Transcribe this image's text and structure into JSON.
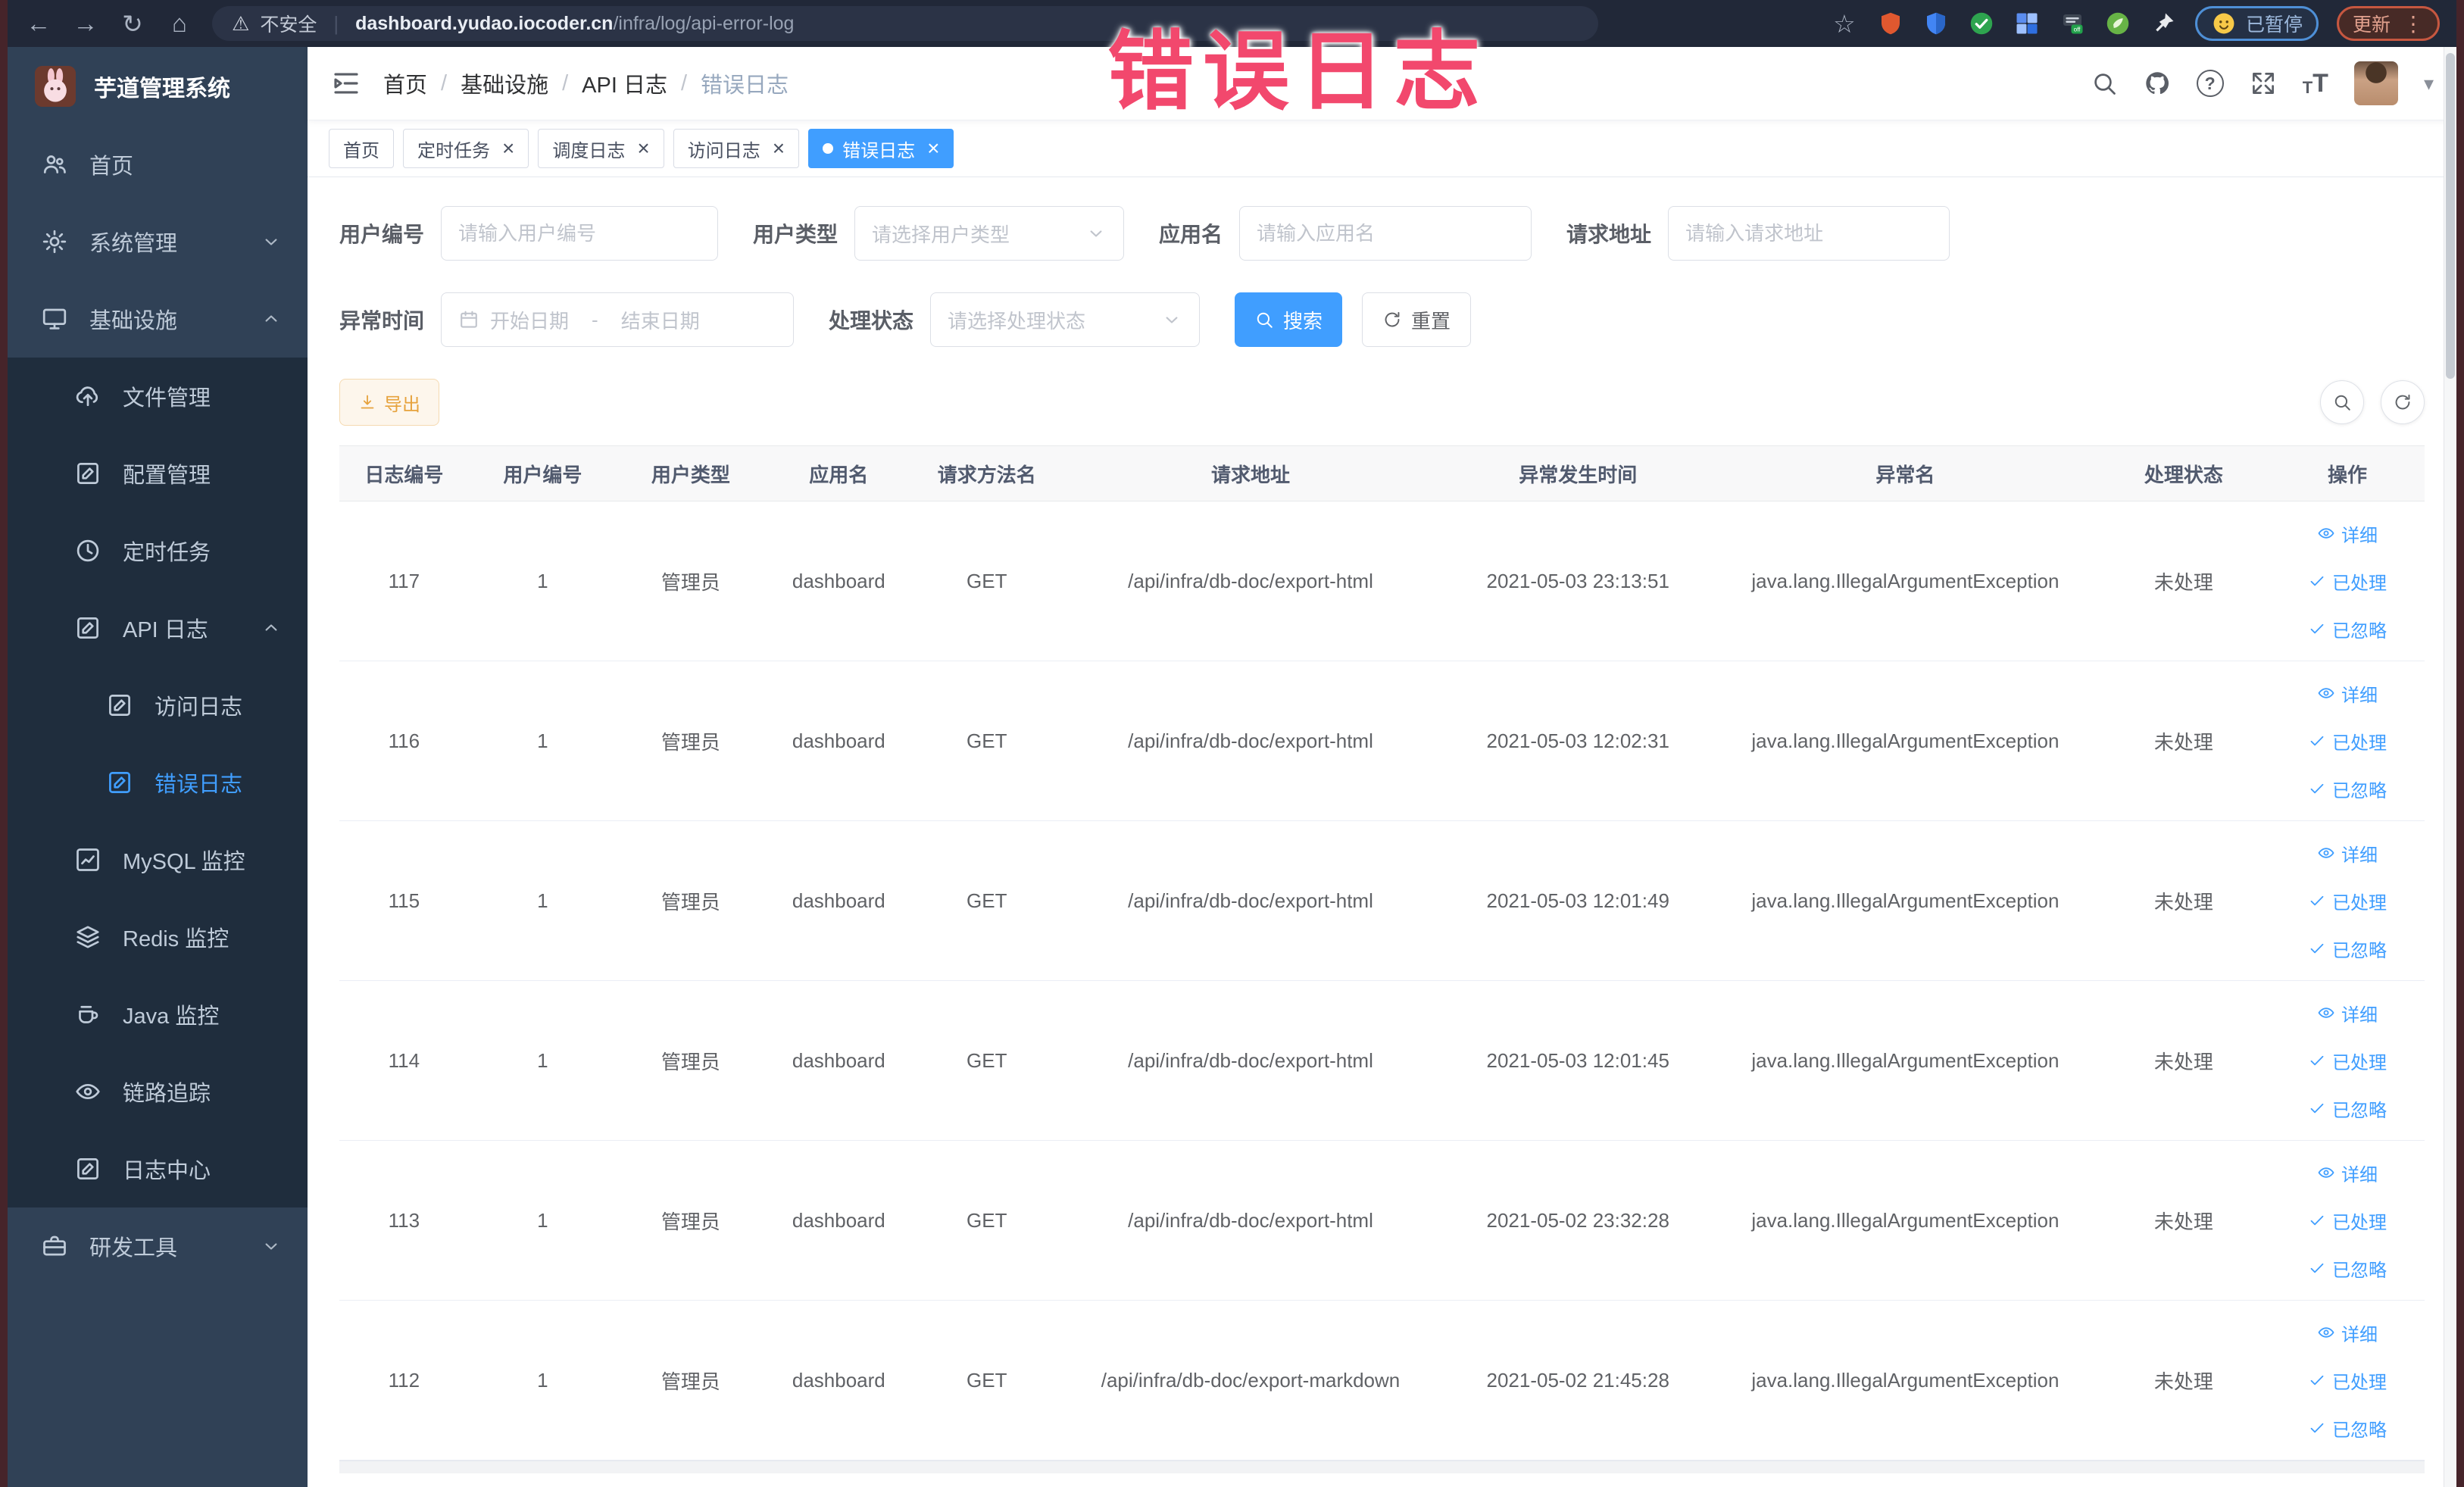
{
  "browser": {
    "security_label": "不安全",
    "url_domain": "dashboard.yudao.iocoder.cn",
    "url_path": "/infra/log/api-error-log",
    "paused_label": "已暂停",
    "update_label": "更新",
    "extension_badge": "off"
  },
  "overlay": {
    "text": "错误日志",
    "color": "#f2486d"
  },
  "sidebar": {
    "logo_title": "芋道管理系统",
    "items": [
      {
        "key": "home",
        "label": "首页",
        "icon": "people-icon",
        "depth": 0
      },
      {
        "key": "system-management",
        "label": "系统管理",
        "icon": "gear-icon",
        "depth": 0,
        "chevron": "down"
      },
      {
        "key": "infrastructure",
        "label": "基础设施",
        "icon": "monitor-icon",
        "depth": 0,
        "chevron": "up"
      },
      {
        "key": "file-management",
        "label": "文件管理",
        "icon": "cloud-upload-icon",
        "depth": 1
      },
      {
        "key": "config-management",
        "label": "配置管理",
        "icon": "edit-icon",
        "depth": 1
      },
      {
        "key": "scheduled-task",
        "label": "定时任务",
        "icon": "clock-icon",
        "depth": 1
      },
      {
        "key": "api-log",
        "label": "API 日志",
        "icon": "edit-icon",
        "depth": 1,
        "chevron": "up"
      },
      {
        "key": "access-log",
        "label": "访问日志",
        "icon": "edit-icon",
        "depth": 2
      },
      {
        "key": "error-log",
        "label": "错误日志",
        "icon": "edit-icon",
        "depth": 2,
        "active": true
      },
      {
        "key": "mysql-monitor",
        "label": "MySQL 监控",
        "icon": "chart-icon",
        "depth": 1
      },
      {
        "key": "redis-monitor",
        "label": "Redis 监控",
        "icon": "layers-icon",
        "depth": 1
      },
      {
        "key": "java-monitor",
        "label": "Java 监控",
        "icon": "coffee-icon",
        "depth": 1
      },
      {
        "key": "trace",
        "label": "链路追踪",
        "icon": "eye-icon",
        "depth": 1
      },
      {
        "key": "log-center",
        "label": "日志中心",
        "icon": "edit-icon",
        "depth": 1
      },
      {
        "key": "dev-tools",
        "label": "研发工具",
        "icon": "toolbox-icon",
        "depth": 0,
        "chevron": "down"
      }
    ]
  },
  "header": {
    "breadcrumb": [
      "首页",
      "基础设施",
      "API 日志",
      "错误日志"
    ],
    "breadcrumb_separator": "/"
  },
  "tabs": [
    {
      "key": "home",
      "label": "首页",
      "closable": false,
      "active": false
    },
    {
      "key": "scheduled-task",
      "label": "定时任务",
      "closable": true,
      "active": false
    },
    {
      "key": "schedule-log",
      "label": "调度日志",
      "closable": true,
      "active": false
    },
    {
      "key": "access-log",
      "label": "访问日志",
      "closable": true,
      "active": false
    },
    {
      "key": "error-log",
      "label": "错误日志",
      "closable": true,
      "active": true
    }
  ],
  "filters": {
    "user_id": {
      "label": "用户编号",
      "placeholder": "请输入用户编号"
    },
    "user_type": {
      "label": "用户类型",
      "placeholder": "请选择用户类型"
    },
    "app_name": {
      "label": "应用名",
      "placeholder": "请输入应用名"
    },
    "request_url": {
      "label": "请求地址",
      "placeholder": "请输入请求地址"
    },
    "exception_time": {
      "label": "异常时间",
      "start_placeholder": "开始日期",
      "separator": "-",
      "end_placeholder": "结束日期"
    },
    "process_status": {
      "label": "处理状态",
      "placeholder": "请选择处理状态"
    },
    "search_label": "搜索",
    "reset_label": "重置"
  },
  "toolbar": {
    "export_label": "导出"
  },
  "table": {
    "columns": [
      "日志编号",
      "用户编号",
      "用户类型",
      "应用名",
      "请求方法名",
      "请求地址",
      "异常发生时间",
      "异常名",
      "处理状态",
      "操作"
    ],
    "row_actions": [
      {
        "key": "detail",
        "label": "详细",
        "icon": "eye-icon"
      },
      {
        "key": "processed",
        "label": "已处理",
        "icon": "check-icon"
      },
      {
        "key": "ignored",
        "label": "已忽略",
        "icon": "check-icon"
      }
    ],
    "rows": [
      {
        "id": "117",
        "user_id": "1",
        "user_type": "管理员",
        "app": "dashboard",
        "method": "GET",
        "url": "/api/infra/db-doc/export-html",
        "time": "2021-05-03 23:13:51",
        "exception": "java.lang.IllegalArgumentException",
        "status": "未处理"
      },
      {
        "id": "116",
        "user_id": "1",
        "user_type": "管理员",
        "app": "dashboard",
        "method": "GET",
        "url": "/api/infra/db-doc/export-html",
        "time": "2021-05-03 12:02:31",
        "exception": "java.lang.IllegalArgumentException",
        "status": "未处理"
      },
      {
        "id": "115",
        "user_id": "1",
        "user_type": "管理员",
        "app": "dashboard",
        "method": "GET",
        "url": "/api/infra/db-doc/export-html",
        "time": "2021-05-03 12:01:49",
        "exception": "java.lang.IllegalArgumentException",
        "status": "未处理"
      },
      {
        "id": "114",
        "user_id": "1",
        "user_type": "管理员",
        "app": "dashboard",
        "method": "GET",
        "url": "/api/infra/db-doc/export-html",
        "time": "2021-05-03 12:01:45",
        "exception": "java.lang.IllegalArgumentException",
        "status": "未处理"
      },
      {
        "id": "113",
        "user_id": "1",
        "user_type": "管理员",
        "app": "dashboard",
        "method": "GET",
        "url": "/api/infra/db-doc/export-html",
        "time": "2021-05-02 23:32:28",
        "exception": "java.lang.IllegalArgumentException",
        "status": "未处理"
      },
      {
        "id": "112",
        "user_id": "1",
        "user_type": "管理员",
        "app": "dashboard",
        "method": "GET",
        "url": "/api/infra/db-doc/export-markdown",
        "time": "2021-05-02 21:45:28",
        "exception": "java.lang.IllegalArgumentException",
        "status": "未处理"
      }
    ]
  },
  "colors": {
    "accent": "#409eff",
    "warning": "#e6a23c",
    "sidebar_bg": "#304156",
    "sidebar_sub_bg": "#1f2d3d",
    "overlay_text": "#f2486d"
  }
}
